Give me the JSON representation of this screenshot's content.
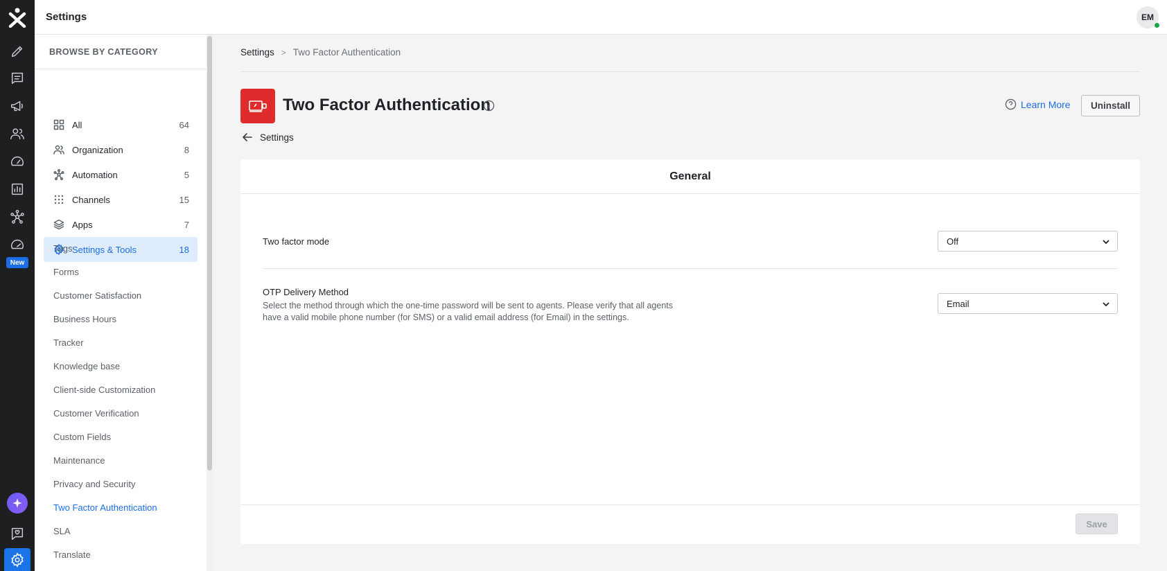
{
  "topbar": {
    "title": "Settings",
    "avatar_initials": "EM"
  },
  "rail": {
    "icons": [
      "logo-icon",
      "pencil-icon",
      "tickets-icon",
      "megaphone-icon",
      "contacts-icon",
      "dashboard-icon",
      "reports-icon",
      "automation-icon",
      "speedometer-icon",
      "ai-sparkle-icon",
      "feedback-icon",
      "settings-icon"
    ],
    "new_badge": "New"
  },
  "sidebar": {
    "heading": "BROWSE BY CATEGORY",
    "categories": [
      {
        "label": "All",
        "count": "64",
        "icon": "grid-icon"
      },
      {
        "label": "Organization",
        "count": "8",
        "icon": "people-icon"
      },
      {
        "label": "Automation",
        "count": "5",
        "icon": "hub-icon"
      },
      {
        "label": "Channels",
        "count": "15",
        "icon": "dots-grid-icon"
      },
      {
        "label": "Apps",
        "count": "7",
        "icon": "layers-icon"
      },
      {
        "label": "Settings & Tools",
        "count": "18",
        "icon": "gear-icon",
        "active": true
      }
    ],
    "sub_items": [
      "Tags",
      "Forms",
      "Customer Satisfaction",
      "Business Hours",
      "Tracker",
      "Knowledge base",
      "Client-side Customization",
      "Customer Verification",
      "Custom Fields",
      "Maintenance",
      "Privacy and Security",
      "Two Factor Authentication",
      "SLA",
      "Translate"
    ],
    "active_sub_item": "Two Factor Authentication"
  },
  "breadcrumb": {
    "root": "Settings",
    "separator": ">",
    "current": "Two Factor Authentication"
  },
  "app": {
    "title": "Two Factor Authentication",
    "learn_more": "Learn More",
    "uninstall": "Uninstall",
    "back_label": "Settings",
    "logo_color": "#df2b2b"
  },
  "card": {
    "title": "General",
    "two_factor": {
      "label": "Two factor mode",
      "value": "Off"
    },
    "otp": {
      "label": "OTP Delivery Method",
      "description": "Select the method through which the one-time password will be sent to agents. Please verify that all agents have a valid mobile phone number (for SMS) or a valid email address (for Email) in the settings.",
      "value": "Email"
    },
    "save": "Save"
  },
  "colors": {
    "accent": "#1b6ee5",
    "rail_bg": "#1d1f21",
    "active_bg": "#dfecfd"
  }
}
